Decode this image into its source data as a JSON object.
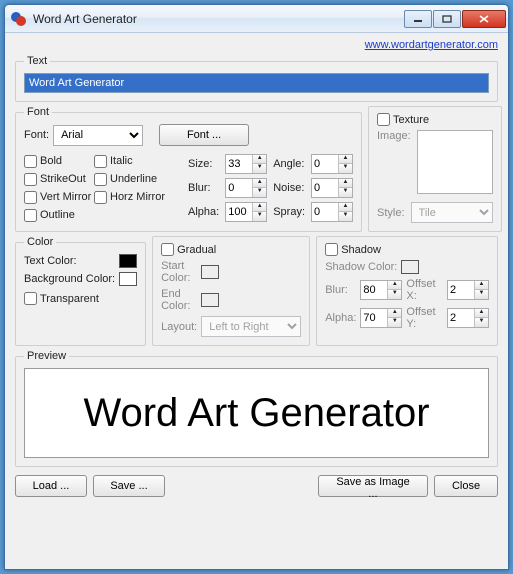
{
  "window": {
    "title": "Word Art Generator"
  },
  "url": "www.wordartgenerator.com",
  "text": {
    "legend": "Text",
    "value": "Word Art Generator"
  },
  "font": {
    "legend": "Font",
    "font_label": "Font:",
    "font_value": "Arial",
    "font_button": "Font ...",
    "bold": "Bold",
    "italic": "Italic",
    "strikeout": "StrikeOut",
    "underline": "Underline",
    "vmirror": "Vert Mirror",
    "hmirror": "Horz Mirror",
    "outline": "Outline",
    "size_label": "Size:",
    "size_value": "33",
    "angle_label": "Angle:",
    "angle_value": "0",
    "blur_label": "Blur:",
    "blur_value": "0",
    "noise_label": "Noise:",
    "noise_value": "0",
    "alpha_label": "Alpha:",
    "alpha_value": "100",
    "spray_label": "Spray:",
    "spray_value": "0"
  },
  "texture": {
    "legend": "Texture",
    "image_label": "Image:",
    "style_label": "Style:",
    "style_value": "Tile"
  },
  "color": {
    "legend": "Color",
    "text_color_label": "Text Color:",
    "text_color": "#000000",
    "bg_color_label": "Background Color:",
    "bg_color": "#ffffff",
    "transparent": "Transparent"
  },
  "gradual": {
    "legend": "Gradual",
    "start_label": "Start Color:",
    "end_label": "End Color:",
    "layout_label": "Layout:",
    "layout_value": "Left to Right"
  },
  "shadow": {
    "legend": "Shadow",
    "color_label": "Shadow Color:",
    "blur_label": "Blur:",
    "blur_value": "80",
    "alpha_label": "Alpha:",
    "alpha_value": "70",
    "ox_label": "Offset X:",
    "ox_value": "2",
    "oy_label": "Offset Y:",
    "oy_value": "2"
  },
  "preview": {
    "legend": "Preview",
    "text": "Word Art Generator"
  },
  "buttons": {
    "load": "Load ...",
    "save": "Save ...",
    "save_image": "Save as Image ...",
    "close": "Close"
  }
}
